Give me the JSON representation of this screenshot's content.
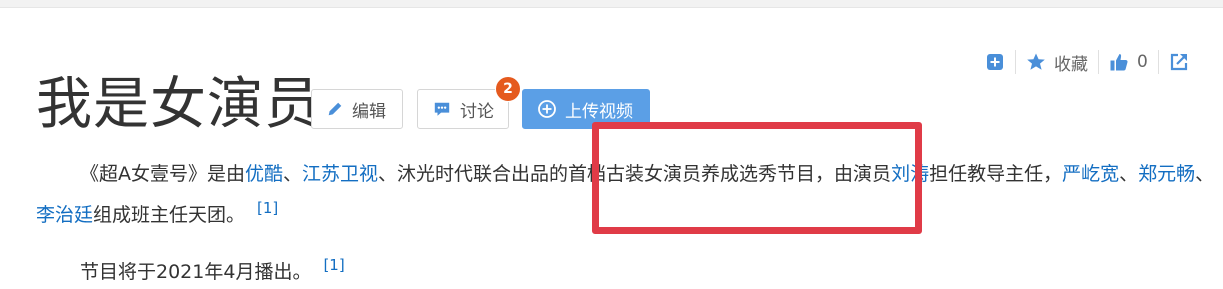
{
  "page": {
    "title": "我是女演员",
    "actions": {
      "collect_label": "收藏",
      "like_count": "0"
    },
    "buttons": {
      "edit": "编辑",
      "discuss": "讨论",
      "discuss_badge": "2",
      "upload": "上传视频"
    }
  },
  "paragraph1": {
    "t1": "《超A女壹号》是由",
    "link_youku": "优酷",
    "t2": "、",
    "link_jiangsu": "江苏卫视",
    "t3": "、沐光时代联合出品的首档古装女演员养成选秀节目，由演员",
    "link_liutao": "刘涛",
    "t4": "担任教导主任，",
    "link_yan": "严屹宽",
    "t5": "、",
    "link_zheng": "郑元畅",
    "t6": "、",
    "link_li": "李治廷",
    "t7": "组成班主任天团。",
    "ref": "[1]"
  },
  "paragraph2": {
    "text": "节目将于2021年4月播出。",
    "ref": "[1]"
  },
  "colors": {
    "link": "#136ec2",
    "badge": "#e55a1e",
    "upload_button": "#5b9fe6",
    "highlight_box": "#e03b47"
  },
  "icons": [
    "add-icon",
    "star-icon",
    "thumbs-up-icon",
    "share-icon",
    "pencil-icon",
    "comment-icon",
    "plus-circle-icon"
  ]
}
